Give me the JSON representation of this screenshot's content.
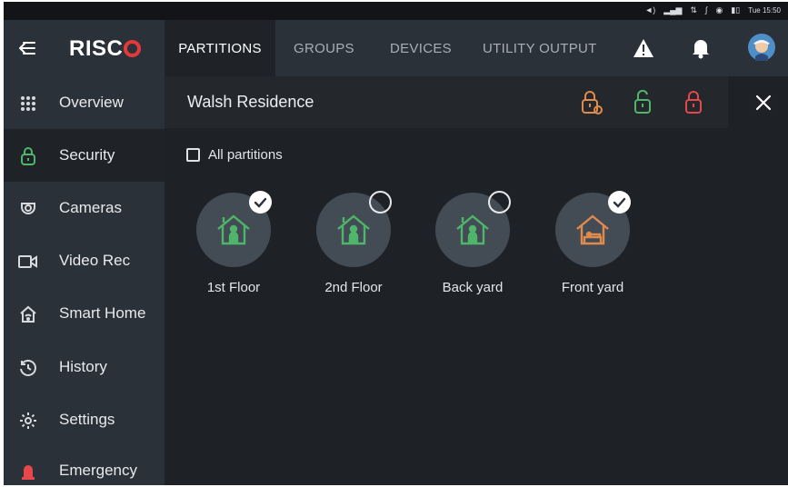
{
  "status_bar": {
    "time": "Tue 15:50"
  },
  "sidebar": {
    "logo": "RISC",
    "items": [
      {
        "label": "Overview",
        "icon": "grid-icon"
      },
      {
        "label": "Security",
        "icon": "lock-icon"
      },
      {
        "label": "Cameras",
        "icon": "camera-icon"
      },
      {
        "label": "Video Rec",
        "icon": "video-icon"
      },
      {
        "label": "Smart Home",
        "icon": "home-wifi-icon"
      },
      {
        "label": "History",
        "icon": "clock-icon"
      },
      {
        "label": "Settings",
        "icon": "gear-icon"
      },
      {
        "label": "Emergency",
        "icon": "siren-icon"
      }
    ],
    "active": "Security"
  },
  "tabs": [
    {
      "label": "PARTITIONS",
      "active": true
    },
    {
      "label": "GROUPS",
      "active": false
    },
    {
      "label": "DEVICES",
      "active": false
    },
    {
      "label": "UTILITY OUTPUT",
      "active": false
    }
  ],
  "header": {
    "title": "Walsh Residence",
    "actions": [
      {
        "name": "partial-arm",
        "color": "#e08a4c"
      },
      {
        "name": "disarm",
        "color": "#4fb56a"
      },
      {
        "name": "full-arm",
        "color": "#e5474b"
      }
    ]
  },
  "all_partitions": {
    "label": "All partitions",
    "checked": false
  },
  "partitions": [
    {
      "label": "1st Floor",
      "selected": true,
      "state": "disarmed",
      "color": "#4fb56a"
    },
    {
      "label": "2nd Floor",
      "selected": false,
      "state": "disarmed",
      "color": "#4fb56a"
    },
    {
      "label": "Back yard",
      "selected": false,
      "state": "disarmed",
      "color": "#4fb56a"
    },
    {
      "label": "Front yard",
      "selected": true,
      "state": "partial",
      "color": "#e08a4c"
    }
  ],
  "colors": {
    "accent_green": "#4fb56a",
    "accent_orange": "#e08a4c",
    "accent_red": "#e5474b",
    "brand_red": "#e23a3a"
  }
}
